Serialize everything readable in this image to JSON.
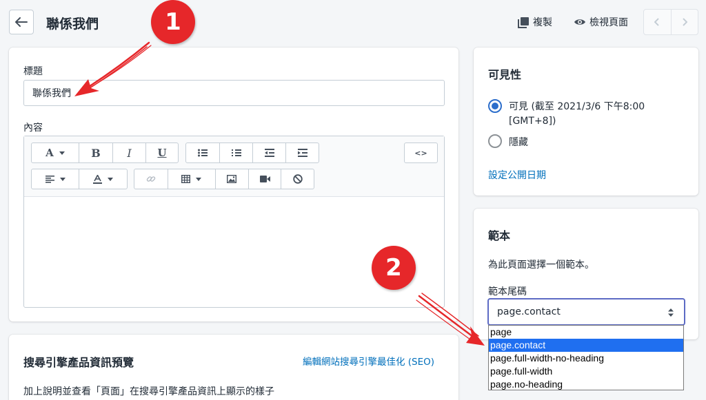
{
  "header": {
    "title": "聯係我們",
    "duplicate_label": "複製",
    "view_label": "檢視頁面"
  },
  "content_card": {
    "title_label": "標題",
    "title_value": "聯係我們",
    "content_label": "內容",
    "toolbar": {
      "font": "A",
      "bold": "B",
      "italic": "I",
      "underline": "U",
      "html": "<>"
    }
  },
  "seo_card": {
    "heading": "搜尋引擎產品資訊預覽",
    "edit_link": "編輯網站搜尋引擎最佳化 (SEO)",
    "description": "加上說明並查看「頁面」在搜尋引擎產品資訊上顯示的樣子"
  },
  "visibility_card": {
    "heading": "可見性",
    "visible_label": "可見 (截至 2021/3/6 下午8:00",
    "visible_label_line2": "[GMT+8])",
    "hidden_label": "隱藏",
    "set_date_link": "設定公開日期",
    "selected": "visible"
  },
  "template_card": {
    "heading": "範本",
    "description": "為此頁面選擇一個範本。",
    "suffix_label": "範本尾碼",
    "selected_value": "page.contact",
    "options": [
      "page",
      "page.contact",
      "page.full-width-no-heading",
      "page.full-width",
      "page.no-heading"
    ]
  },
  "annotations": {
    "badge1": "1",
    "badge2": "2"
  },
  "colors": {
    "accent": "#5c6ac4",
    "link": "#006fbb",
    "radio": "#2c6ecb",
    "badge": "#e6272a",
    "option_highlight": "#1f6ff0"
  },
  "icons": [
    "back-arrow-icon",
    "duplicate-icon",
    "eye-icon",
    "chevron-left-icon",
    "chevron-right-icon",
    "bulleted-list-icon",
    "numbered-list-icon",
    "outdent-icon",
    "indent-icon",
    "align-left-icon",
    "text-color-icon",
    "link-icon",
    "table-icon",
    "image-icon",
    "video-icon",
    "clear-format-icon",
    "select-arrows-icon"
  ]
}
